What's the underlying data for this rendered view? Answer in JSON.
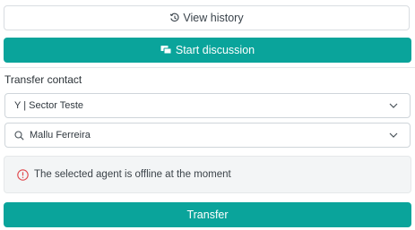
{
  "actions": {
    "view_history_label": "View history",
    "start_discussion_label": "Start discussion"
  },
  "transfer": {
    "title": "Transfer contact",
    "sector_value": "Y | Sector Teste",
    "agent_value": "Mallu Ferreira",
    "offline_message": "The selected agent is offline at the moment",
    "submit_label": "Transfer"
  },
  "colors": {
    "primary": "#0aa49b",
    "alert_icon": "#e0474c",
    "border": "#cfd5da"
  },
  "icons": {
    "history": "history-icon",
    "discussion": "chat-icon",
    "search": "search-icon",
    "chevron": "chevron-down-icon",
    "alert": "alert-circle-icon"
  }
}
